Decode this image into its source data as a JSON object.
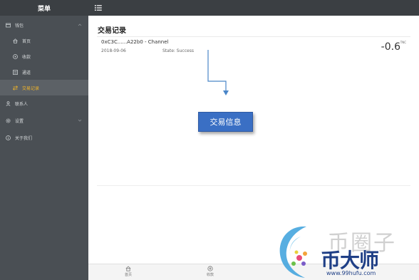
{
  "sidebar": {
    "header": "菜单",
    "items": [
      {
        "label": "钱包",
        "icon": "wallet-icon",
        "level": 1,
        "chevron": "up"
      },
      {
        "label": "首页",
        "icon": "home-icon",
        "level": 2
      },
      {
        "label": "收款",
        "icon": "receive-icon",
        "level": 2
      },
      {
        "label": "通道",
        "icon": "channel-icon",
        "level": 2
      },
      {
        "label": "交易记录",
        "icon": "transaction-icon",
        "level": 2,
        "active": true
      },
      {
        "label": "联系人",
        "icon": "contacts-icon",
        "level": 1
      },
      {
        "label": "设置",
        "icon": "settings-icon",
        "level": 1,
        "chevron": "down"
      },
      {
        "label": "关于我们",
        "icon": "info-icon",
        "level": 1
      }
    ]
  },
  "topbar": {
    "menu_icon": "list-icon"
  },
  "main": {
    "title": "交易记录",
    "transaction": {
      "name": "0xC3C......A22b0 - Channel",
      "date": "2018-09-06",
      "state": "State:  Success",
      "amount": "-0.6",
      "unit": "TNC"
    }
  },
  "callout": {
    "label": "交易信息"
  },
  "tabbar": {
    "tabs": [
      {
        "label": "首页",
        "icon": "home-icon"
      },
      {
        "label": "收款",
        "icon": "receive-icon"
      }
    ]
  },
  "watermark": {
    "main_text": "币大师",
    "back_text": "币圈子",
    "url": "www.99hufu.com"
  },
  "colors": {
    "sidebar_bg": "#4a4f54",
    "topbar_bg": "#3b3f43",
    "active_text": "#f0b429",
    "callout_bg": "#3a6fc4",
    "arrow": "#4a86c8"
  }
}
